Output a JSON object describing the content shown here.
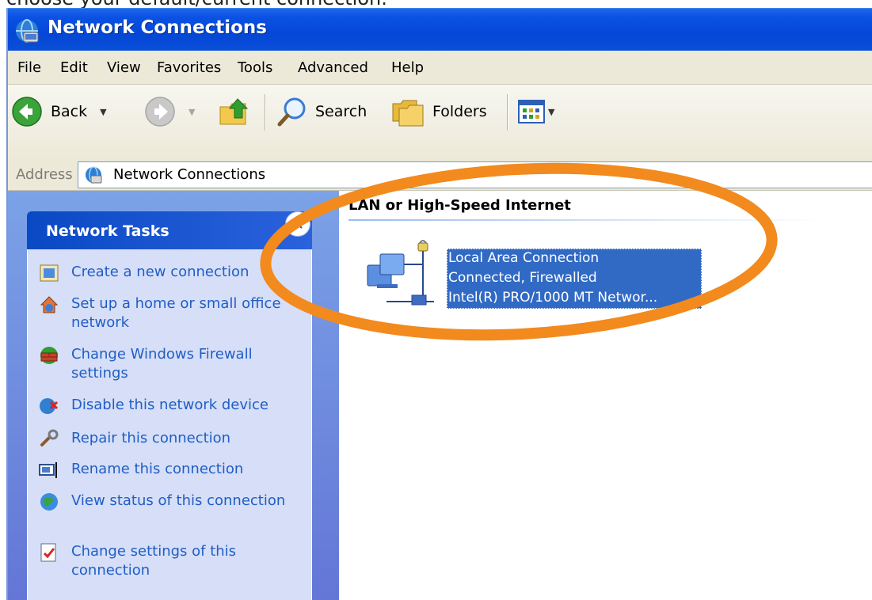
{
  "caption": "choose your default/current connection.",
  "window": {
    "title": "Network Connections"
  },
  "menu": [
    "File",
    "Edit",
    "View",
    "Favorites",
    "Tools",
    "Advanced",
    "Help"
  ],
  "toolbar": {
    "back_label": "Back",
    "search_label": "Search",
    "folders_label": "Folders"
  },
  "address": {
    "label": "Address",
    "value": "Network Connections"
  },
  "sidebar": {
    "title": "Network Tasks",
    "tasks": [
      {
        "label": "Create a new connection",
        "icon": "new-connection-icon"
      },
      {
        "label": "Set up a home or small office network",
        "icon": "home-network-icon"
      },
      {
        "label": "Change Windows Firewall settings",
        "icon": "firewall-icon"
      },
      {
        "label": "Disable this network device",
        "icon": "disable-device-icon"
      },
      {
        "label": "Repair this connection",
        "icon": "repair-icon"
      },
      {
        "label": "Rename this connection",
        "icon": "rename-icon"
      },
      {
        "label": "View status of this connection",
        "icon": "status-icon"
      },
      {
        "label": "Change settings of this connection",
        "icon": "settings-icon"
      }
    ]
  },
  "content": {
    "group_header": "LAN or High-Speed Internet",
    "connection": {
      "name": "Local Area Connection",
      "status": "Connected, Firewalled",
      "device": "Intel(R) PRO/1000 MT Networ..."
    }
  },
  "colors": {
    "highlight_oval": "#f28a1e",
    "selection": "#316ac5",
    "task_link": "#215dc6"
  }
}
